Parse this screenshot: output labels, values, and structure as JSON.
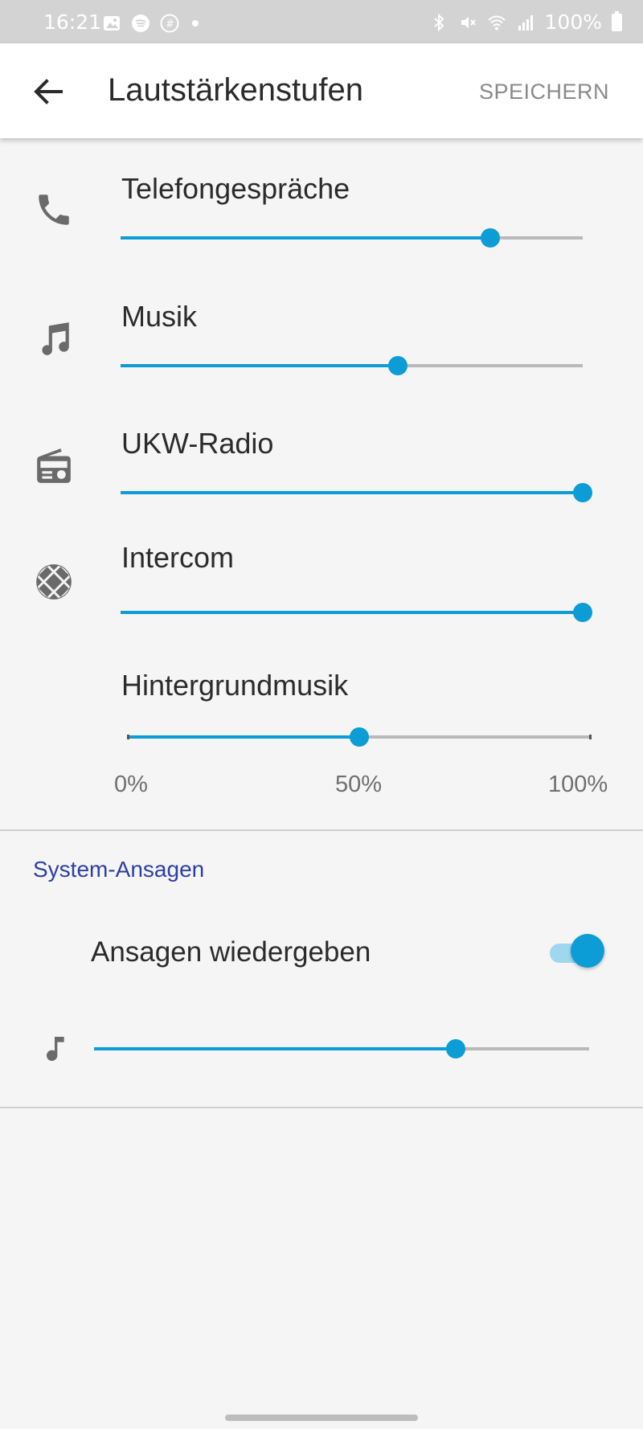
{
  "status_bar": {
    "time": "16:21",
    "battery": "100%",
    "left_icons": [
      "image-icon",
      "spotify-icon",
      "threads-icon",
      "dot-icon"
    ],
    "right_icons": [
      "bluetooth-icon",
      "mute-icon",
      "wifi-icon",
      "signal-icon",
      "battery-icon"
    ]
  },
  "app_bar": {
    "title": "Lautstärkenstufen",
    "save_label": "SPEICHERN",
    "back_icon": "arrow-back-icon"
  },
  "volume_sliders": [
    {
      "label": "Telefongespräche",
      "icon": "phone-icon",
      "value": 0.8
    },
    {
      "label": "Musik",
      "icon": "music-note-icon",
      "value": 0.6
    },
    {
      "label": "UKW-Radio",
      "icon": "radio-icon",
      "value": 1.0
    },
    {
      "label": "Intercom",
      "icon": "intercom-icon",
      "value": 1.0
    },
    {
      "label": "Hintergrundmusik",
      "icon": "",
      "value": 0.5
    }
  ],
  "scale_labels": [
    "0%",
    "50%",
    "100%"
  ],
  "system_announcements": {
    "section_title": "System-Ansagen",
    "toggle_label": "Ansagen wiedergeben",
    "toggle_on": true,
    "volume_icon": "single-note-icon",
    "volume_value": 0.73
  },
  "colors": {
    "accent": "#0c9dd6",
    "section_title": "#2c3fa5",
    "track": "#b9b9b9",
    "status_bar": "#d3d3d3"
  }
}
